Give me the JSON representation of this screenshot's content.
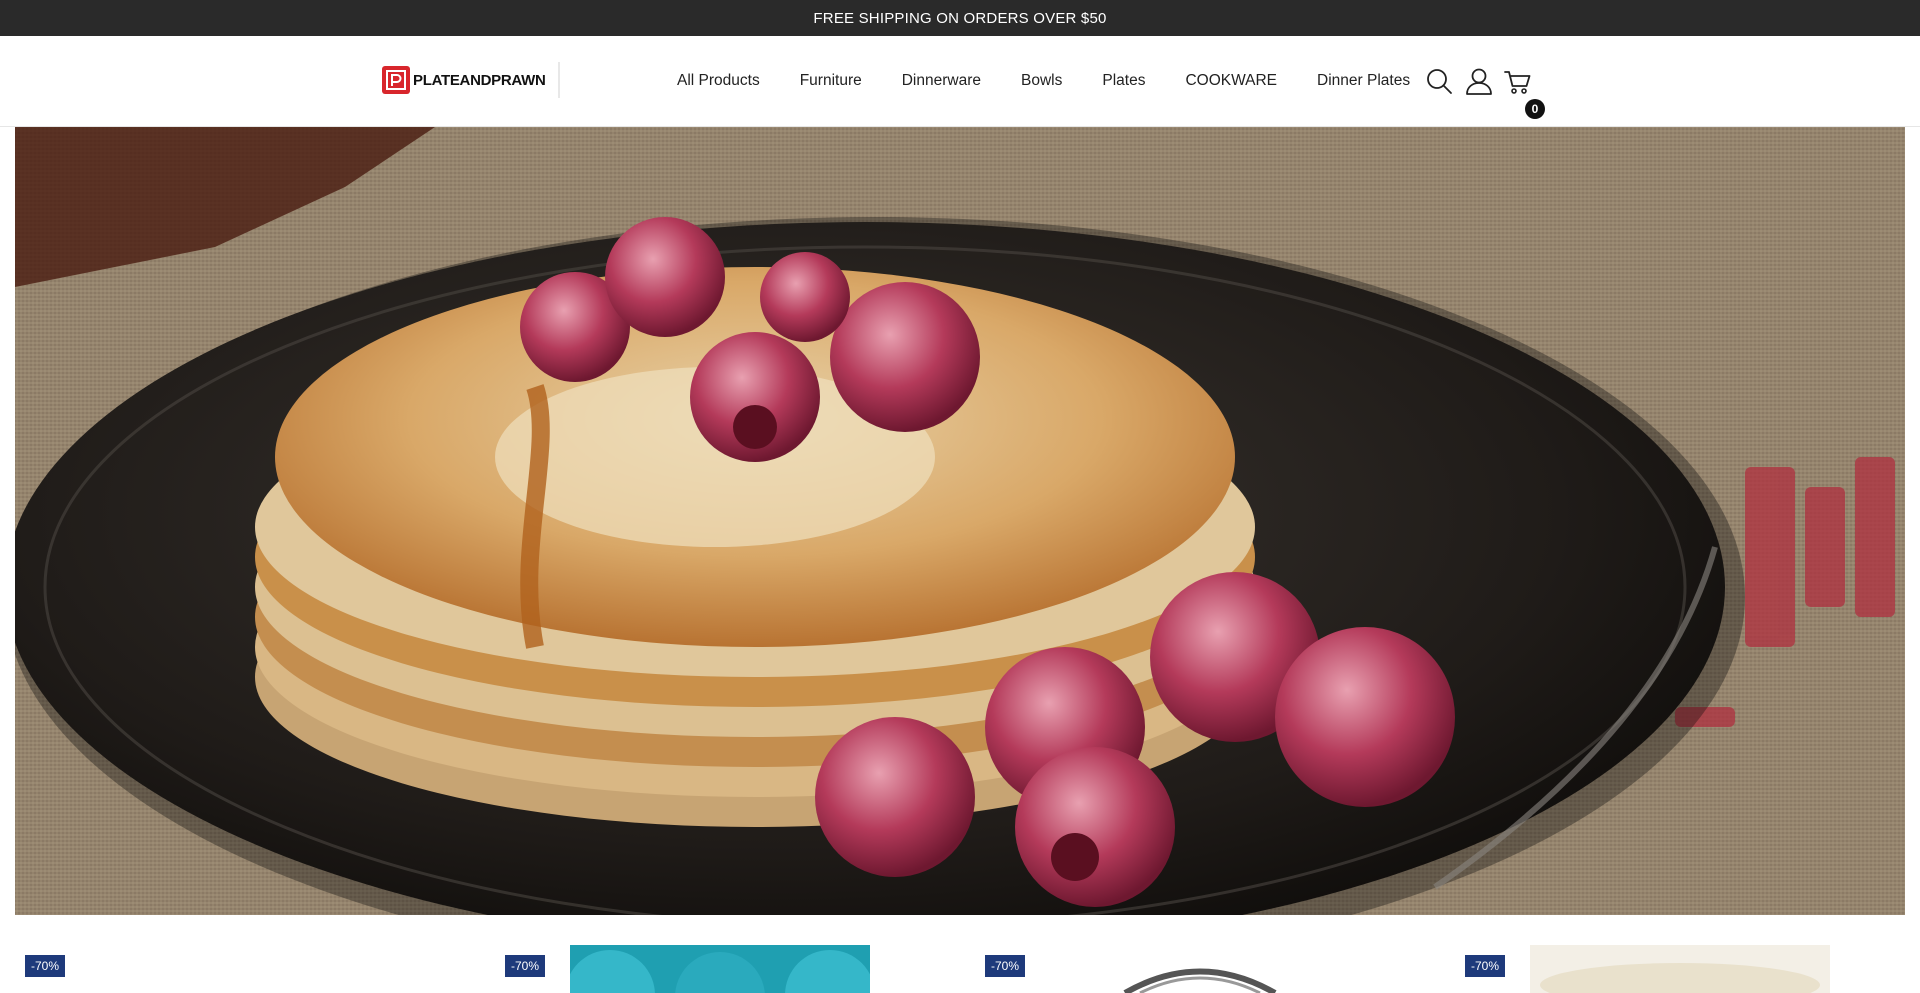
{
  "announcement": {
    "text": "FREE SHIPPING ON ORDERS OVER $50"
  },
  "header": {
    "logo_text": "PLATEANDPRAWN",
    "nav": [
      "All Products",
      "Furniture",
      "Dinnerware",
      "Bowls",
      "Plates",
      "COOKWARE",
      "Dinner Plates"
    ],
    "icons": [
      "search-icon",
      "user-icon",
      "cart-icon"
    ],
    "cart_count": "0"
  },
  "hero": {
    "alt": ""
  },
  "products": {
    "badges": [
      "-70%",
      "-70%",
      "-70%",
      "-70%"
    ]
  },
  "colors": {
    "announcement_bg": "#2a2a2a",
    "badge_bg": "#1e3a7b",
    "logo_red": "#d8262c"
  }
}
